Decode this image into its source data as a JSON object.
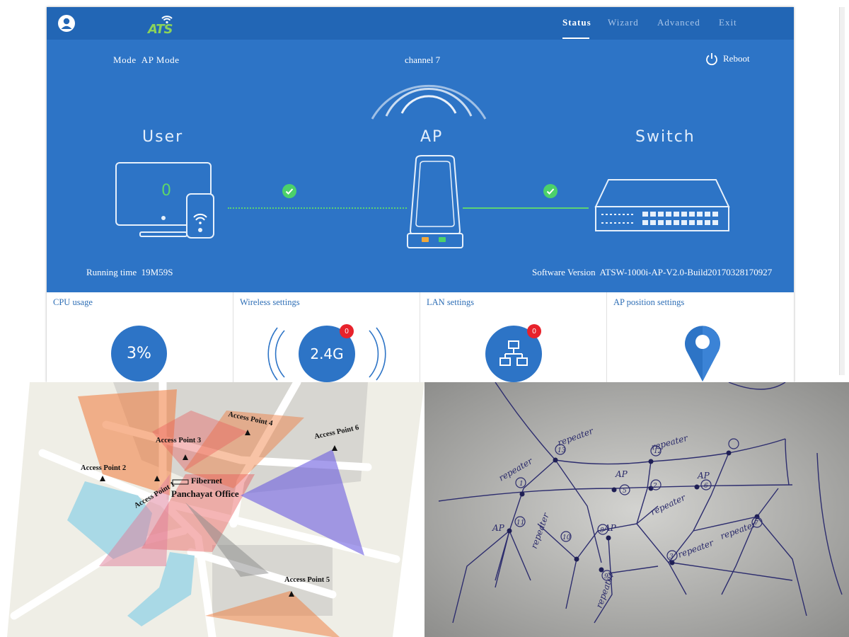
{
  "header": {
    "logo_text": "ATS",
    "nav": {
      "status": "Status",
      "wizard": "Wizard",
      "advanced": "Advanced",
      "exit": "Exit"
    },
    "active_tab": "Status"
  },
  "status": {
    "mode_label": "Mode",
    "mode_value": "AP Mode",
    "channel_label": "channel",
    "channel_value": "7",
    "reboot_label": "Reboot",
    "user_label": "User",
    "ap_label": "AP",
    "switch_label": "Switch",
    "user_count": "0",
    "running_time_label": "Running time",
    "running_time_value": "19M59S",
    "software_version_label": "Software Version",
    "software_version_value": "ATSW-1000i-AP-V2.0-Build20170328170927"
  },
  "cards": {
    "cpu": {
      "title": "CPU usage",
      "value": "3%"
    },
    "wireless": {
      "title": "Wireless settings",
      "value": "2.4G",
      "badge": "0"
    },
    "lan": {
      "title": "LAN settings",
      "badge": "0",
      "icon": "network-tree-icon"
    },
    "ap_position": {
      "title": "AP position settings",
      "icon": "map-pin-icon"
    }
  },
  "map": {
    "labels": {
      "ap1": "Access Point 1",
      "ap2": "Access Point 2",
      "ap3": "Access Point 3",
      "ap4": "Access Point 4",
      "ap5": "Access Point 5",
      "ap6": "Access Point 6",
      "fibernet": "Fibernet",
      "office": "Panchayat Office"
    }
  },
  "sketch": {
    "labels": {
      "r13": "repeater",
      "r12": "repeater",
      "l1": "repeater",
      "ap5": "AP",
      "ap6": "AP",
      "r2": "repeater",
      "ap11": "AP",
      "r10": "repeater",
      "ap8": "AP",
      "r3": "repeater",
      "r7": "repeater",
      "r9": "repeater"
    },
    "nums": {
      "n13": "13",
      "n12": "12",
      "n1": "1",
      "n5": "5",
      "n6": "6",
      "n2": "2",
      "n11": "11",
      "n10": "10",
      "n8": "8",
      "n3": "3",
      "n7": "7",
      "n9": "9"
    }
  },
  "colors": {
    "topbar": "#2266b5",
    "hero": "#2d74c6",
    "badge": "#e8222b",
    "check": "#4cd16a",
    "orange_coverage": "#f07a3a",
    "purple_coverage": "#6b5ce0"
  }
}
